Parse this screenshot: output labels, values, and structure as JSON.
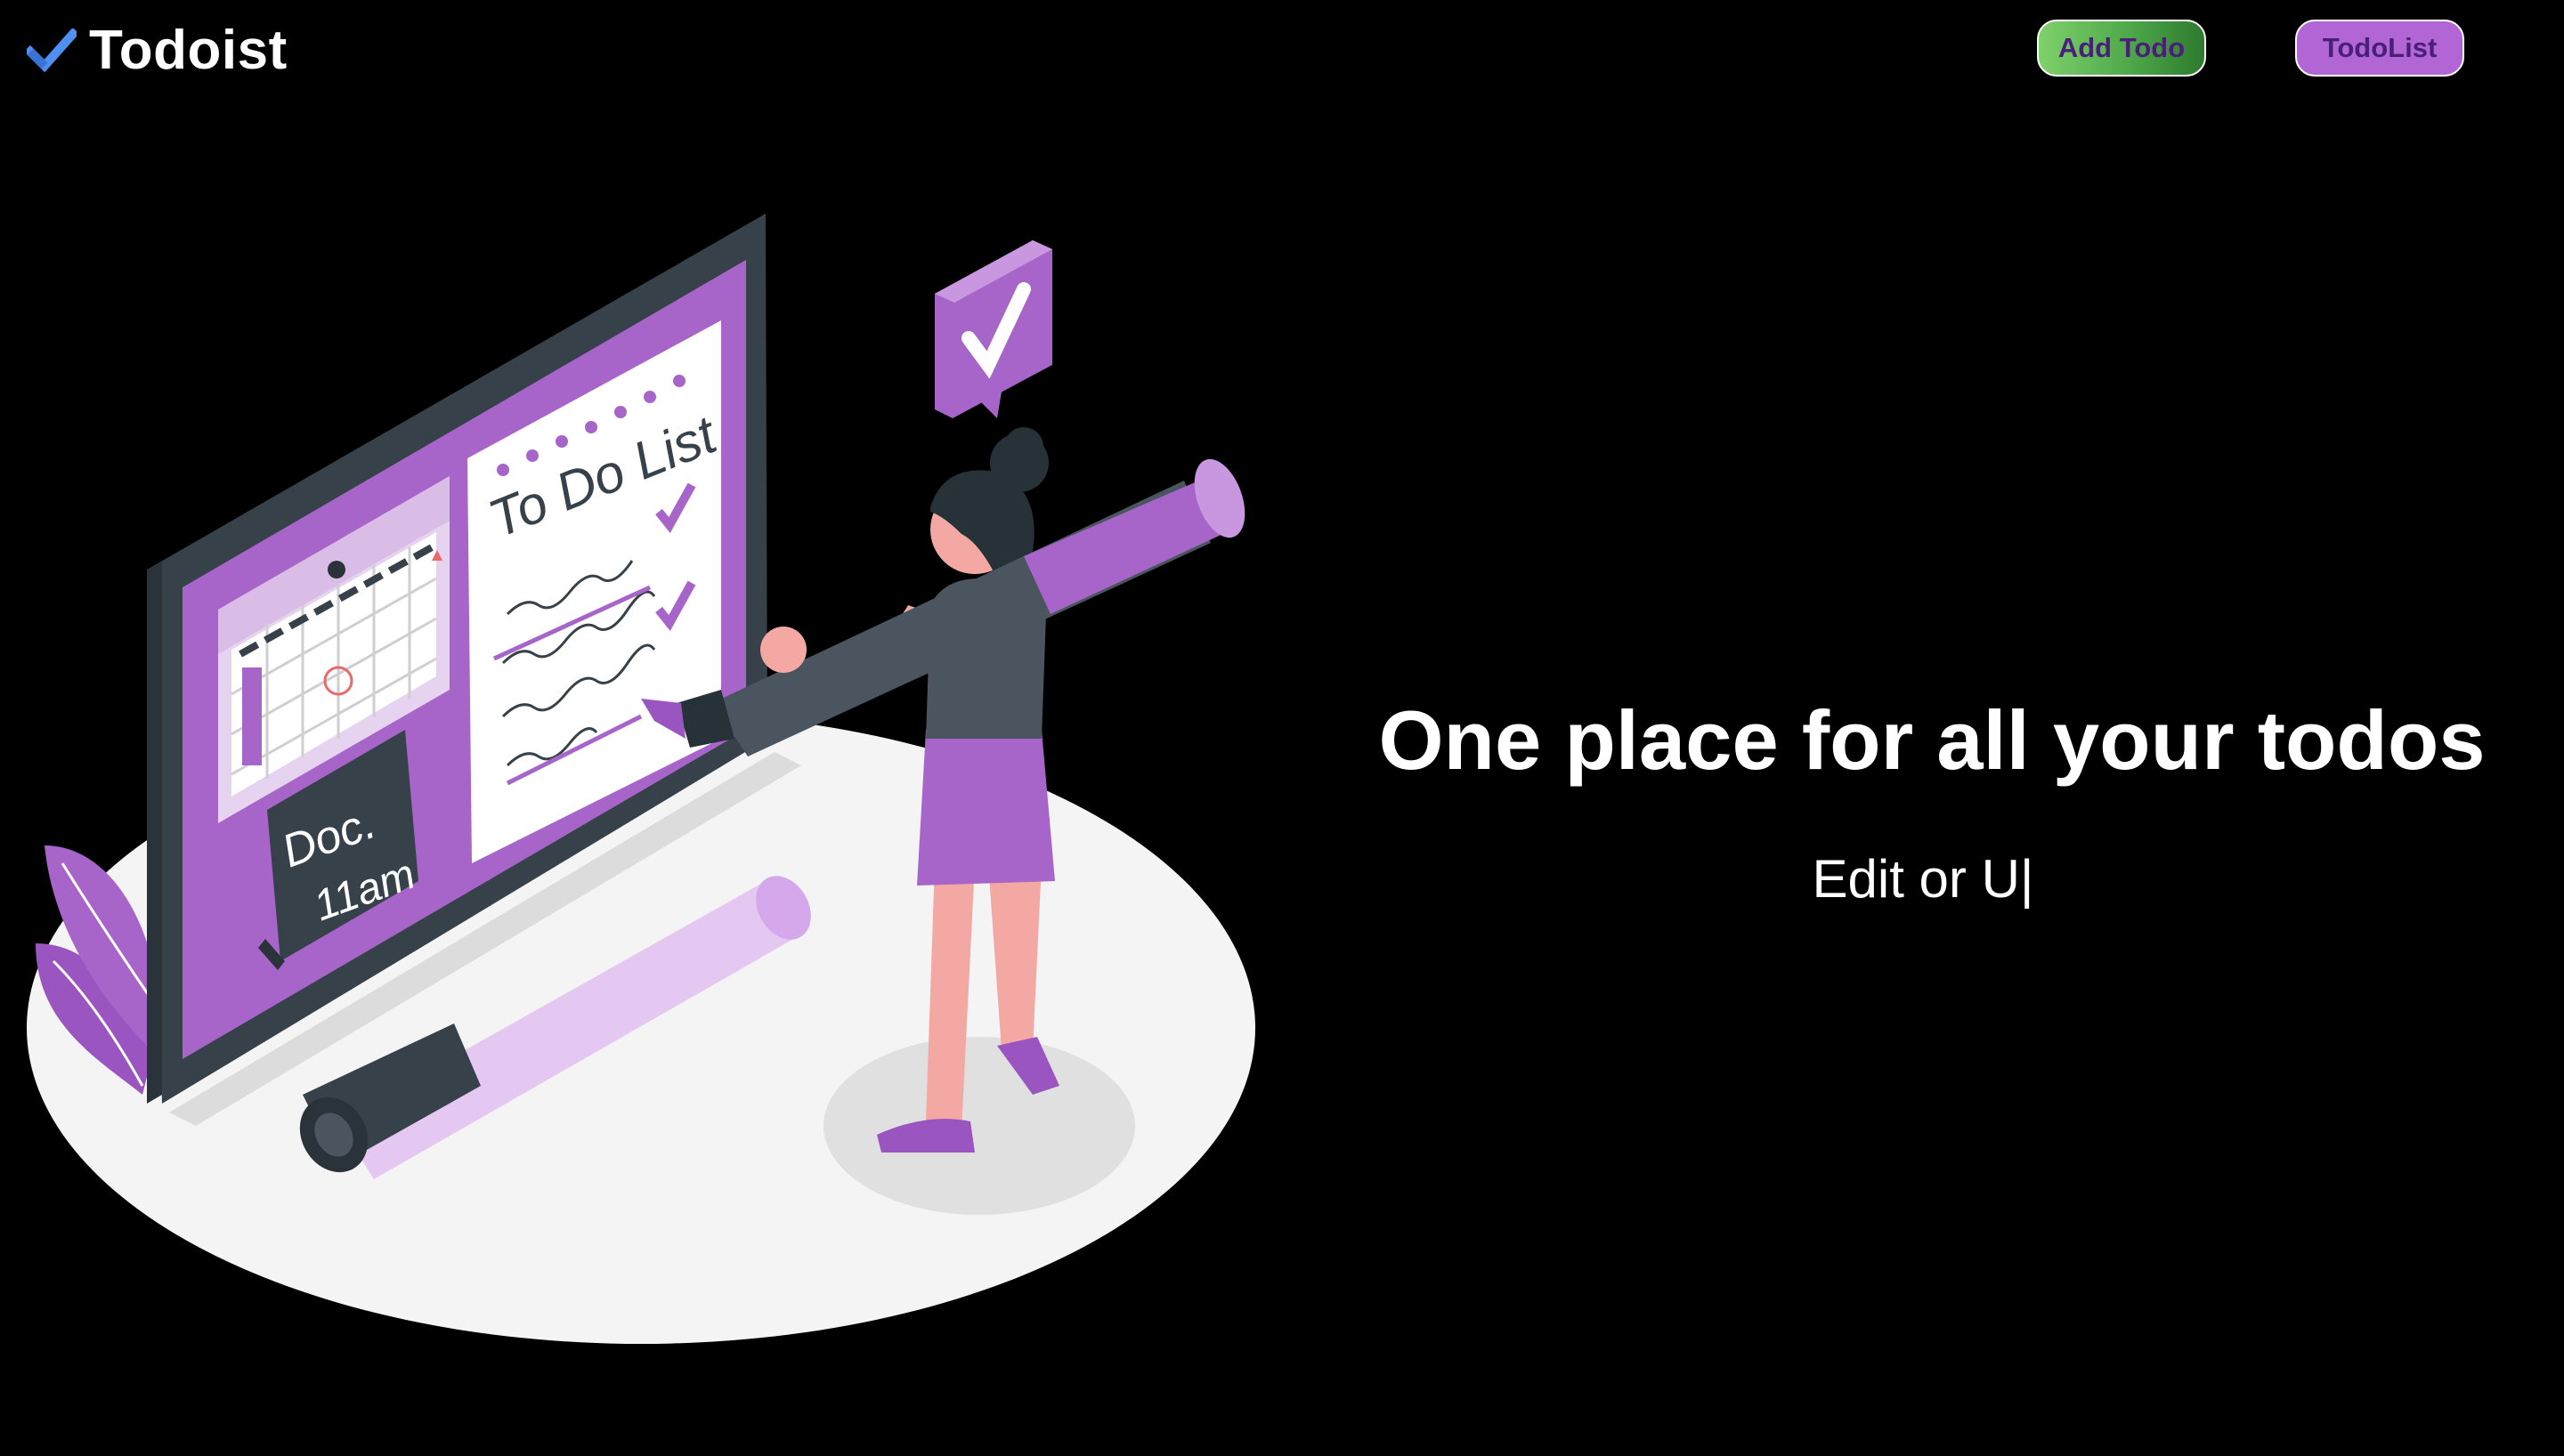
{
  "header": {
    "brand_name": "Todoist",
    "brand_icon": "checkmark-icon",
    "add_todo_label": "Add Todo",
    "todolist_label": "TodoList"
  },
  "hero": {
    "title": "One place for all your todos",
    "typed_text": "Edit or U",
    "cursor": "|"
  },
  "illustration": {
    "board_heading": "To Do List",
    "note_line1": "Doc.",
    "note_line2": "11am"
  },
  "colors": {
    "background": "#000000",
    "accent_purple": "#a865c9",
    "add_button_green": "#5cb85c",
    "button_text": "#4a1f7a",
    "brand_check": "#4f8ff0"
  }
}
